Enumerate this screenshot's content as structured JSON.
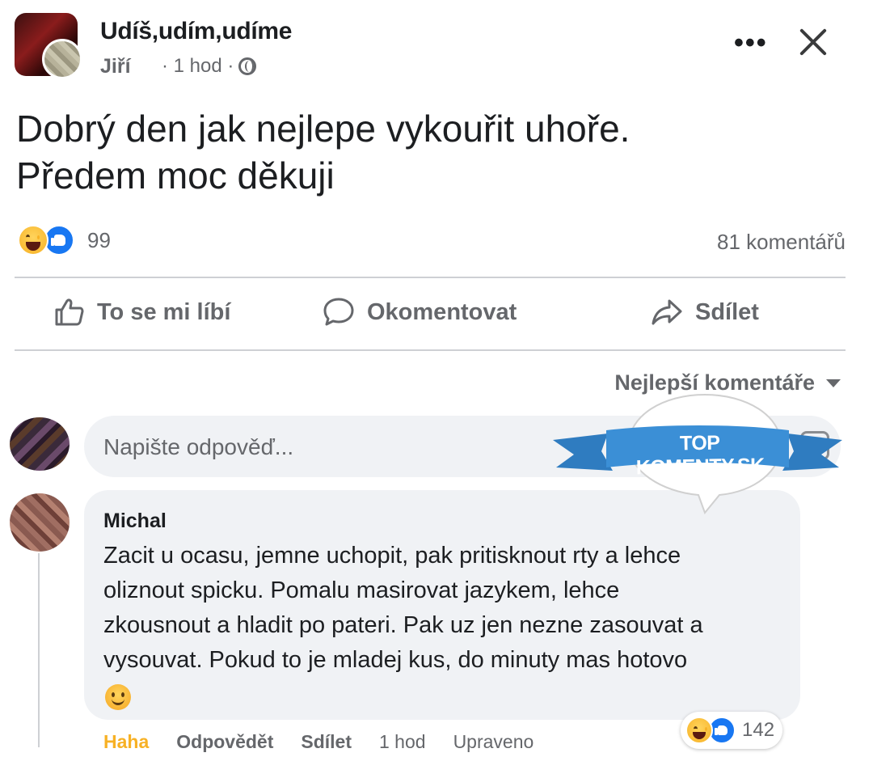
{
  "header": {
    "group_name": "Udíš,udím,udíme",
    "author": "Jiří",
    "time": "· 1 hod ·"
  },
  "post": {
    "text_line1": "Dobrý den jak nejlepe vykouřit uhoře.",
    "text_line2": "Předem moc děkuji",
    "reaction_count": "99",
    "comment_count": "81 komentářů"
  },
  "actions": {
    "like": "To se mi líbí",
    "comment": "Okomentovat",
    "share": "Sdílet"
  },
  "sort_label": "Nejlepší komentáře",
  "reply": {
    "placeholder": "Napište odpověď..."
  },
  "watermark": {
    "text": "TOP KOMENTY.SK",
    "ribbon_color": "#3b8fd6",
    "bubble_color": "#ffffff"
  },
  "comment": {
    "name": "Michal",
    "lines": [
      "Zacit u ocasu, jemne uchopit, pak pritisknout rty a lehce",
      "oliznout spicku. Pomalu masirovat jazykem, lehce",
      "zkousnout a hladit po pateri. Pak uz jen nezne zasouvat a",
      "vysouvat. Pokud to je mladej kus, do minuty mas hotovo"
    ],
    "reaction_count": "142",
    "actions": {
      "haha": "Haha",
      "reply": "Odpovědět",
      "share": "Sdílet",
      "time": "1 hod",
      "edited": "Upraveno"
    }
  },
  "colors": {
    "accent": "#1877f2",
    "haha": "#f7b125",
    "muted": "#65676b",
    "bubble": "#f0f2f5"
  }
}
